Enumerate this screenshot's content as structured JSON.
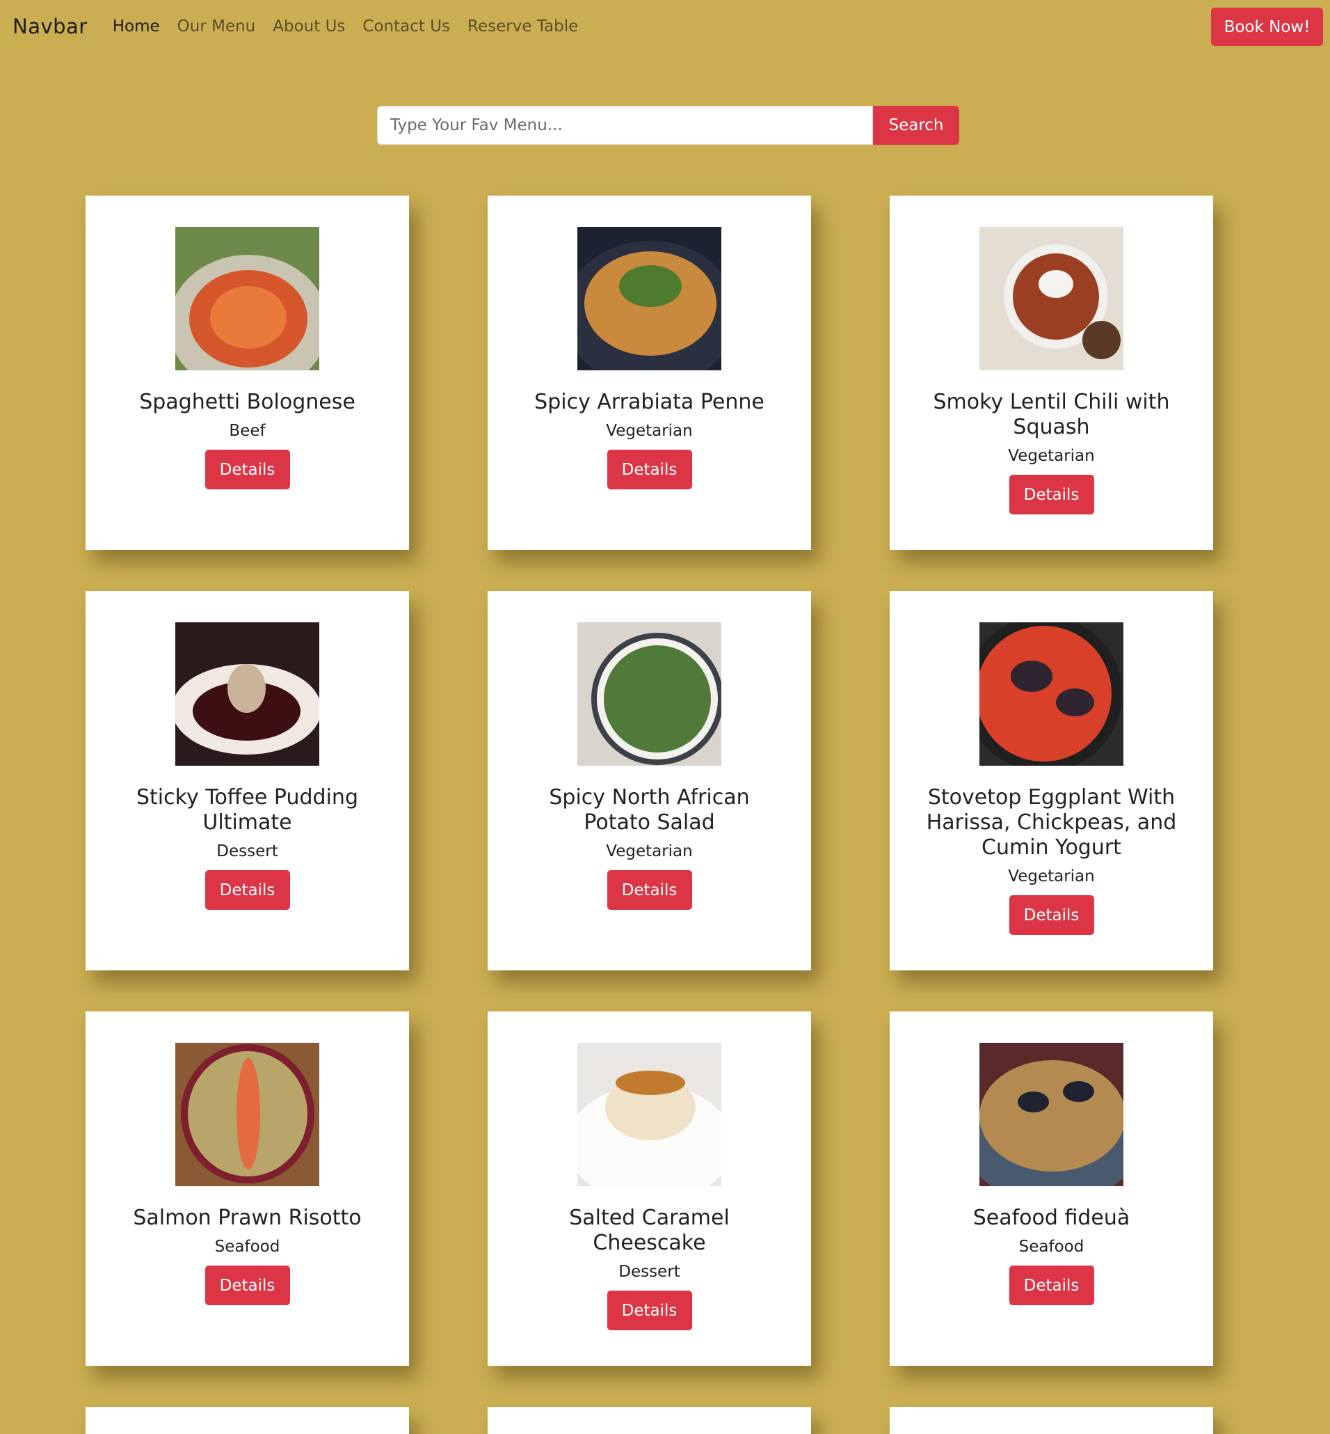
{
  "navbar": {
    "brand": "Navbar",
    "links": [
      "Home",
      "Our Menu",
      "About Us",
      "Contact Us",
      "Reserve Table"
    ],
    "book_label": "Book Now!"
  },
  "search": {
    "placeholder": "Type Your Fav Menu...",
    "button_label": "Search"
  },
  "colors": {
    "background": "#cbae52",
    "accent": "#dc3545",
    "card": "#ffffff"
  },
  "menu": [
    {
      "title": "Spaghetti Bolognese",
      "category": "Beef",
      "button": "Details",
      "image": "spaghetti-plate-image"
    },
    {
      "title": "Spicy Arrabiata Penne",
      "category": "Vegetarian",
      "button": "Details",
      "image": "penne-pan-image"
    },
    {
      "title": "Smoky Lentil Chili with Squash",
      "category": "Vegetarian",
      "button": "Details",
      "image": "chili-bowl-image"
    },
    {
      "title": "Sticky Toffee Pudding Ultimate",
      "category": "Dessert",
      "button": "Details",
      "image": "toffee-pudding-image"
    },
    {
      "title": "Spicy North African Potato Salad",
      "category": "Vegetarian",
      "button": "Details",
      "image": "potato-salad-image"
    },
    {
      "title": "Stovetop Eggplant With Harissa, Chickpeas, and Cumin Yogurt",
      "category": "Vegetarian",
      "button": "Details",
      "image": "eggplant-skillet-image"
    },
    {
      "title": "Salmon Prawn Risotto",
      "category": "Seafood",
      "button": "Details",
      "image": "salmon-risotto-image"
    },
    {
      "title": "Salted Caramel Cheescake",
      "category": "Dessert",
      "button": "Details",
      "image": "caramel-cheesecake-image"
    },
    {
      "title": "Seafood fideuà",
      "category": "Seafood",
      "button": "Details",
      "image": "seafood-fideua-image"
    }
  ]
}
